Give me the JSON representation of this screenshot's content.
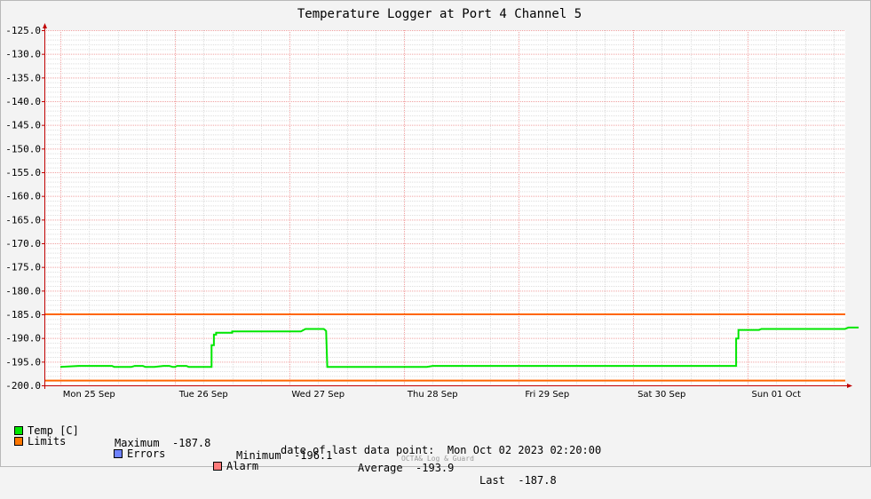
{
  "chart_data": {
    "type": "line",
    "title": "Temperature Logger at Port 4 Channel 5",
    "ylim": [
      -200,
      -125
    ],
    "y_ticks": [
      "-125.0",
      "-130.0",
      "-135.0",
      "-140.0",
      "-145.0",
      "-150.0",
      "-155.0",
      "-160.0",
      "-165.0",
      "-170.0",
      "-175.0",
      "-180.0",
      "-185.0",
      "-190.0",
      "-195.0",
      "-200.0"
    ],
    "x_day_labels": [
      "Mon 25 Sep",
      "Tue 26 Sep",
      "Wed 27 Sep",
      "Thu 28 Sep",
      "Fri 29 Sep",
      "Sat 30 Sep",
      "Sun 01 Oct"
    ],
    "grid": true,
    "series": [
      {
        "name": "Temp [C]",
        "color": "#00e600",
        "points": [
          [
            0.0,
            -196.1
          ],
          [
            0.16,
            -195.9
          ],
          [
            0.45,
            -195.9
          ],
          [
            0.47,
            -196.1
          ],
          [
            0.62,
            -196.1
          ],
          [
            0.65,
            -195.9
          ],
          [
            0.72,
            -195.9
          ],
          [
            0.74,
            -196.1
          ],
          [
            0.82,
            -196.1
          ],
          [
            0.9,
            -195.9
          ],
          [
            0.95,
            -195.9
          ],
          [
            0.98,
            -196.1
          ],
          [
            1.0,
            -196.1
          ],
          [
            1.02,
            -195.9
          ],
          [
            1.1,
            -195.9
          ],
          [
            1.12,
            -196.1
          ],
          [
            1.32,
            -196.1
          ],
          [
            1.32,
            -191.5
          ],
          [
            1.34,
            -191.5
          ],
          [
            1.34,
            -189.3
          ],
          [
            1.36,
            -189.3
          ],
          [
            1.36,
            -188.9
          ],
          [
            1.5,
            -188.9
          ],
          [
            1.5,
            -188.6
          ],
          [
            2.1,
            -188.6
          ],
          [
            2.14,
            -188.1
          ],
          [
            2.3,
            -188.1
          ],
          [
            2.32,
            -188.5
          ],
          [
            2.33,
            -196.1
          ],
          [
            3.2,
            -196.1
          ],
          [
            3.25,
            -195.9
          ],
          [
            4.0,
            -195.9
          ],
          [
            5.0,
            -195.9
          ],
          [
            5.9,
            -195.9
          ],
          [
            5.9,
            -190.1
          ],
          [
            5.92,
            -190.1
          ],
          [
            5.92,
            -188.3
          ],
          [
            6.1,
            -188.3
          ],
          [
            6.12,
            -188.1
          ],
          [
            6.85,
            -188.1
          ],
          [
            6.88,
            -187.8
          ],
          [
            6.97,
            -187.8
          ]
        ]
      },
      {
        "name": "Limits",
        "color": "#ff6600",
        "lines": [
          -185,
          -199
        ]
      }
    ]
  },
  "legend": {
    "temp": {
      "label": "Temp [C]",
      "color": "#00e600"
    },
    "limits": {
      "label": "Limits",
      "color": "#ff7700"
    },
    "errors": {
      "label": "Errors",
      "color": "#6f82ff"
    },
    "alarm": {
      "label": "Alarm",
      "color": "#ff7b7b"
    },
    "maximum_label": "Maximum",
    "maximum_value": "-187.8",
    "minimum_label": "Minimum",
    "minimum_value": "-196.1",
    "average_label": "Average",
    "average_value": "-193.9",
    "last_label": "Last",
    "last_value": "-187.8"
  },
  "footer": {
    "last_point_label": "date of last data point:",
    "last_point_value": "Mon Oct 02 2023 02:20:00",
    "watermark": "OCTA& Log & Guard"
  }
}
